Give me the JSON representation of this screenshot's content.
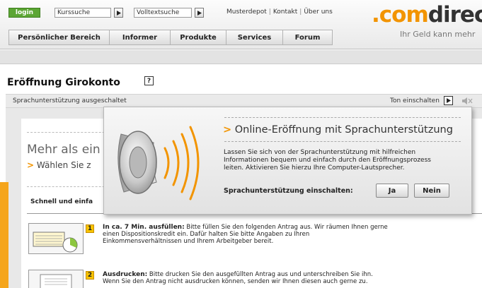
{
  "header": {
    "login_label": "login",
    "search_quotes_value": "Kurssuche",
    "search_fulltext_value": "Volltextsuche",
    "top_links": [
      "Musterdepot",
      "Kontakt",
      "Über uns"
    ],
    "logo_dot": ".",
    "logo_com": "com",
    "logo_rest": "direct",
    "slogan": "Ihr Geld kann mehr",
    "nav": [
      "Persönlicher Bereich",
      "Informer",
      "Produkte",
      "Services",
      "Forum"
    ]
  },
  "page": {
    "title": "Eröffnung Girokonto",
    "help_label": "?"
  },
  "audio_bar": {
    "status": "Sprachunterstützung ausgeschaltet",
    "toggle_label": "Ton einschalten"
  },
  "content": {
    "heading": "Mehr als ein",
    "subheading_arrow": ">",
    "subheading": "Wählen Sie z",
    "section_label": "Schnell und einfa",
    "steps": [
      {
        "number": "1",
        "title": "In ca. 7 Min. ausfüllen:",
        "text_line1": "Bitte füllen Sie den folgenden Antrag aus. Wir räumen Ihnen gerne",
        "text_line2": "einen Dispositionskredit ein. Dafür halten Sie bitte Angaben zu Ihren",
        "text_line3": "Einkommensverhältnissen und Ihrem Arbeitgeber bereit."
      },
      {
        "number": "2",
        "title": "Ausdrucken:",
        "text_line1": "Bitte drucken Sie den ausgefüllten Antrag aus und unterschreiben Sie ihn.",
        "text_line2": "Wenn Sie den Antrag nicht ausdrucken können, senden wir Ihnen diesen auch gerne zu."
      }
    ]
  },
  "popup": {
    "title_arrow": ">",
    "title": "Online-Eröffnung mit Sprachunterstützung",
    "body_line1": "Lassen Sie sich von der Sprachunterstützung mit hilfreichen",
    "body_line2": "Informationen bequem und einfach durch den Eröffnungsprozess",
    "body_line3": "leiten. Aktivieren Sie hierzu Ihre Computer-Lautsprecher.",
    "question": "Sprachunterstützung einschalten:",
    "yes_label": "Ja",
    "no_label": "Nein"
  },
  "colors": {
    "brand_orange": "#f29400",
    "login_green": "#5ca634",
    "step_badge": "#f9c400"
  }
}
